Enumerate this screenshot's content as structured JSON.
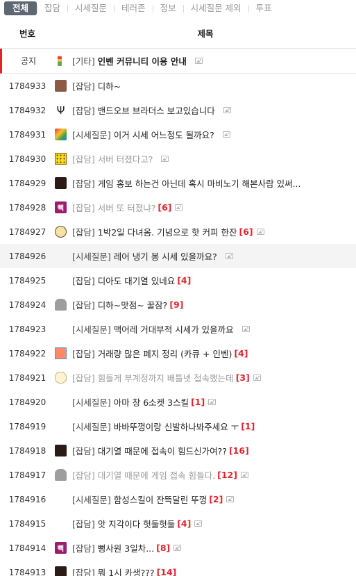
{
  "tabs": [
    {
      "label": "전체",
      "active": true
    },
    {
      "label": "잡담",
      "active": false
    },
    {
      "label": "시세질문",
      "active": false
    },
    {
      "label": "테러존",
      "active": false
    },
    {
      "label": "정보",
      "active": false
    },
    {
      "label": "시세질문 제외",
      "active": false
    },
    {
      "label": "투표",
      "active": false
    }
  ],
  "header": {
    "num_label": "번호",
    "title_label": "제목"
  },
  "notice": {
    "num": "공지",
    "category": "[기타]",
    "subject": "인벤 커뮤니티 이용 안내",
    "icon": "notice-bookmark-icon",
    "has_image": true
  },
  "posts": [
    {
      "num": "1784933",
      "category": "[잡담]",
      "subject": "디하~",
      "comments": "",
      "has_image": false,
      "icon": "cat-avatar",
      "dim": false,
      "highlight": false
    },
    {
      "num": "1784932",
      "category": "[잡담]",
      "subject": "밴드오브 브라더스 보고있습니다",
      "comments": "",
      "has_image": true,
      "icon": "fork-avatar",
      "dim": false,
      "highlight": false
    },
    {
      "num": "1784931",
      "category": "[시세질문]",
      "subject": "이거 시세 어느정도 될까요?",
      "comments": "",
      "has_image": true,
      "icon": "colorful-avatar",
      "dim": false,
      "highlight": false
    },
    {
      "num": "1784930",
      "category": "[잡담]",
      "subject": "서버 터졌다고?",
      "comments": "",
      "has_image": true,
      "icon": "dice-avatar",
      "dim": true,
      "highlight": false
    },
    {
      "num": "1784929",
      "category": "[잡담]",
      "subject": "게임 홍보 하는건 아닌데 혹시 마비노기 해본사람 있써...",
      "comments": "",
      "has_image": false,
      "icon": "girl-avatar",
      "dim": false,
      "highlight": false
    },
    {
      "num": "1784928",
      "category": "[잡담]",
      "subject": "서버 또 터졌냐?",
      "comments": "[6]",
      "has_image": true,
      "icon": "ppyeong-avatar",
      "dim": true,
      "highlight": false
    },
    {
      "num": "1784927",
      "category": "[잡담]",
      "subject": "1박2일 다녀옴. 기념으로 핫 커피 한잔",
      "comments": "[6]",
      "has_image": true,
      "icon": "bear-avatar",
      "dim": false,
      "highlight": false
    },
    {
      "num": "1784926",
      "category": "[시세질문]",
      "subject": "레어 냉기 봉 시세 있을까요?",
      "comments": "",
      "has_image": true,
      "icon": "",
      "dim": false,
      "highlight": true
    },
    {
      "num": "1784925",
      "category": "[잡담]",
      "subject": "디아도 대기열 있네요",
      "comments": "[4]",
      "has_image": false,
      "icon": "",
      "dim": false,
      "highlight": false
    },
    {
      "num": "1784924",
      "category": "[잡담]",
      "subject": "디하~맛점~ 꿀잠?",
      "comments": "[9]",
      "has_image": false,
      "icon": "rock-avatar",
      "dim": false,
      "highlight": false
    },
    {
      "num": "1784923",
      "category": "[시세질문]",
      "subject": "맥어레 거대부적 시세가 있을까요",
      "comments": "",
      "has_image": true,
      "icon": "",
      "dim": false,
      "highlight": false
    },
    {
      "num": "1784922",
      "category": "[잡담]",
      "subject": "거래량 많은 폐지 정리 (카큐 + 인벤)",
      "comments": "[4]",
      "has_image": false,
      "icon": "gift-avatar",
      "dim": false,
      "highlight": false
    },
    {
      "num": "1784921",
      "category": "[잡담]",
      "subject": "힘들게 부계정까지 배틀넷 접속했는데",
      "comments": "[3]",
      "has_image": true,
      "icon": "ghost-avatar",
      "dim": true,
      "highlight": false
    },
    {
      "num": "1784920",
      "category": "[시세질문]",
      "subject": "아마 창 6소켓 3스킬",
      "comments": "[1]",
      "has_image": true,
      "icon": "",
      "dim": false,
      "highlight": false
    },
    {
      "num": "1784919",
      "category": "[시세질문]",
      "subject": "바바뚜껑이랑 신발하나봐주세요 ㅜ",
      "comments": "[1]",
      "has_image": false,
      "icon": "",
      "dim": false,
      "highlight": false
    },
    {
      "num": "1784918",
      "category": "[잡담]",
      "subject": "대기열 때문에 접속이 힘드신가여??",
      "comments": "[16]",
      "has_image": false,
      "icon": "girl-avatar",
      "dim": false,
      "highlight": false
    },
    {
      "num": "1784917",
      "category": "[잡담]",
      "subject": "대기열 때문에 게임 접속 힘들다.",
      "comments": "[12]",
      "has_image": true,
      "icon": "rock-avatar",
      "dim": true,
      "highlight": false
    },
    {
      "num": "1784916",
      "category": "[시세질문]",
      "subject": "함성스킬이 잔뜩달린 뚜껑",
      "comments": "[2]",
      "has_image": true,
      "icon": "",
      "dim": false,
      "highlight": false
    },
    {
      "num": "1784915",
      "category": "[잡담]",
      "subject": "앗 지각이다 헛둘헛둘",
      "comments": "[4]",
      "has_image": true,
      "icon": "",
      "dim": false,
      "highlight": false
    },
    {
      "num": "1784914",
      "category": "[잡담]",
      "subject": "뻥사원 3일차...",
      "comments": "[8]",
      "has_image": true,
      "icon": "ppyeong-avatar",
      "dim": false,
      "highlight": false
    },
    {
      "num": "1784913",
      "category": "[잡담]",
      "subject": "뭐 1시 카생???",
      "comments": "[14]",
      "has_image": false,
      "icon": "girl-avatar",
      "dim": false,
      "highlight": false
    }
  ]
}
